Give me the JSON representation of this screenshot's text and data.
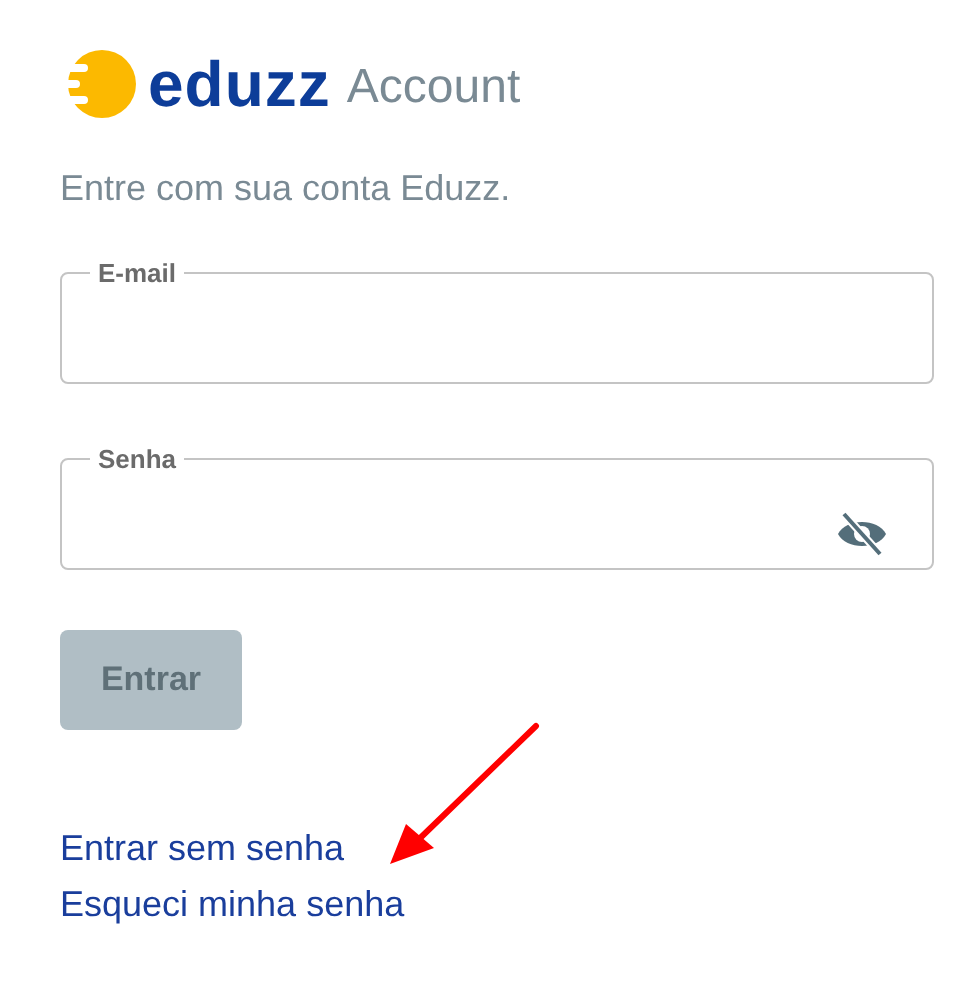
{
  "logo": {
    "brand": "eduzz",
    "product": "Account"
  },
  "subtitle": "Entre com sua conta Eduzz.",
  "fields": [
    {
      "label": "E-mail",
      "kind": "text"
    },
    {
      "label": "Senha",
      "kind": "password"
    }
  ],
  "submit": {
    "label": "Entrar",
    "disabled": true
  },
  "links": [
    "Entrar sem senha",
    "Esqueci minha senha"
  ]
}
